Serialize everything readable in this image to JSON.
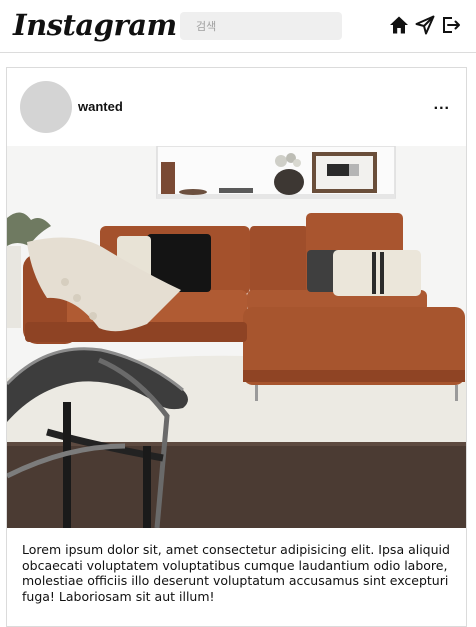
{
  "header": {
    "logo_text": "Instagram",
    "search_placeholder": "검색",
    "icons": [
      "home-icon",
      "send-icon",
      "logout-icon"
    ]
  },
  "post": {
    "username": "wanted",
    "more_label": "...",
    "image_description_icon": "photo",
    "caption": "Lorem ipsum dolor sit, amet consectetur adipisicing elit. Ipsa aliquid obcaecati voluptatem voluptatibus cumque laudantium odio labore, molestiae officiis illo deserunt voluptatum accusamus sint excepturi fuga! Laboriosam sit aut illum!"
  },
  "colors": {
    "sofa": "#a8552f",
    "wall": "#f6f6f6",
    "floor": "#4a3a33",
    "rug": "#ece9e2"
  }
}
